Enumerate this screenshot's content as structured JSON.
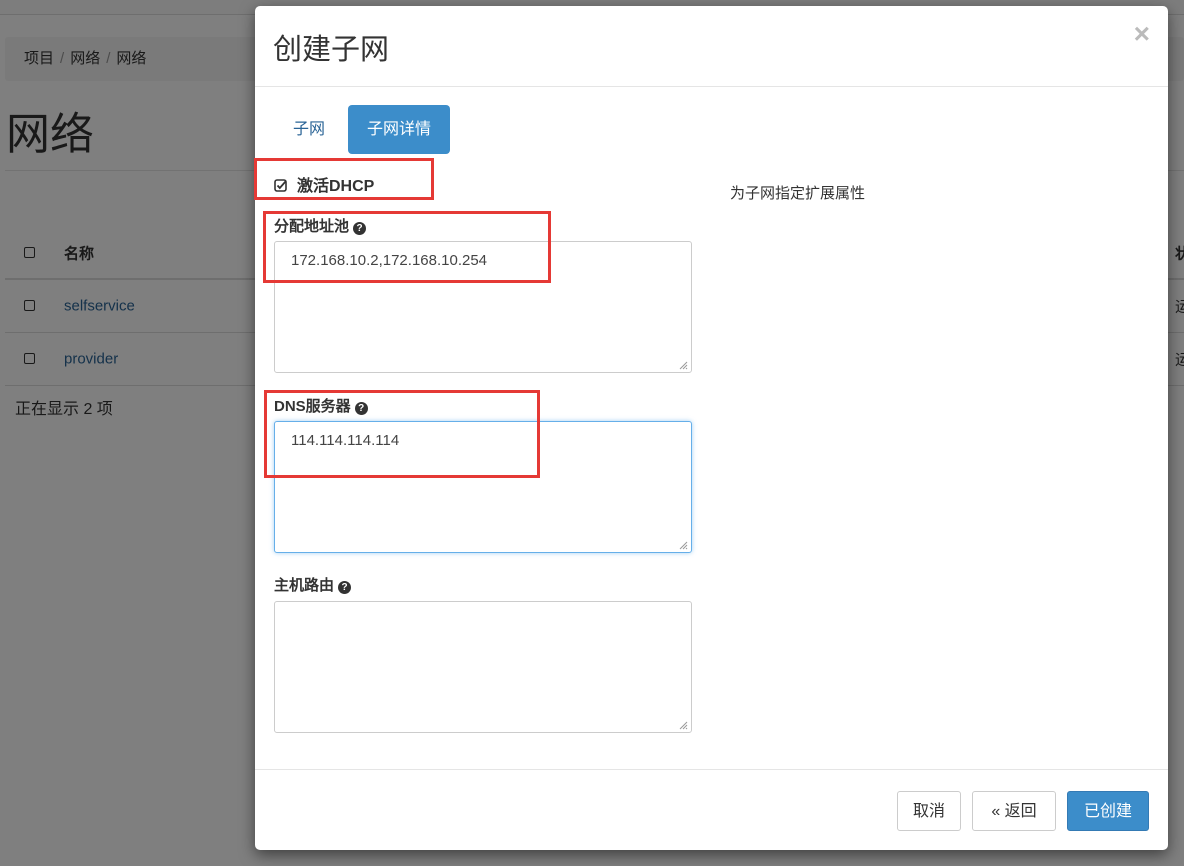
{
  "background": {
    "breadcrumb": [
      "项目",
      "网络",
      "网络"
    ],
    "page_title": "网络",
    "table": {
      "header_name": "名称",
      "header_right_partial": "状",
      "rows": [
        {
          "name": "selfservice",
          "right_partial": "运"
        },
        {
          "name": "provider",
          "right_partial": "运"
        }
      ]
    },
    "count_text": "正在显示 2 项"
  },
  "modal": {
    "title": "创建子网",
    "close_symbol": "×",
    "tabs": [
      {
        "label": "子网",
        "active": false
      },
      {
        "label": "子网详情",
        "active": true
      }
    ],
    "enable_dhcp": {
      "label": "激活DHCP",
      "checked": true
    },
    "allocation_pools": {
      "label": "分配地址池",
      "value": "172.168.10.2,172.168.10.254"
    },
    "dns_servers": {
      "label": "DNS服务器",
      "value": "114.114.114.114"
    },
    "host_routes": {
      "label": "主机路由",
      "value": ""
    },
    "help_text": "为子网指定扩展属性",
    "buttons": {
      "cancel": "取消",
      "back": "« 返回",
      "create": "已创建"
    },
    "help_icon_glyph": "?"
  },
  "colors": {
    "primary": "#3c8dca",
    "link": "#2a6496",
    "annotation_red": "#e53935"
  }
}
